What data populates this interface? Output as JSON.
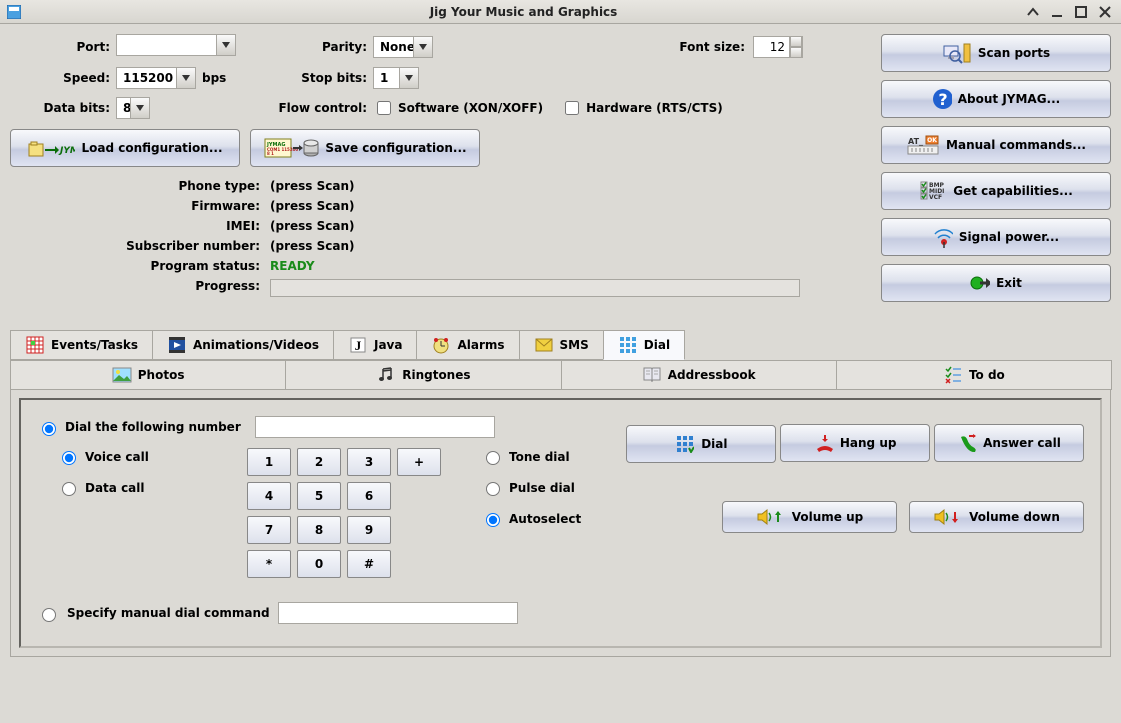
{
  "window": {
    "title": "Jig Your Music and Graphics"
  },
  "settings": {
    "port_label": "Port:",
    "port_value": "",
    "speed_label": "Speed:",
    "speed_value": "115200",
    "speed_unit": "bps",
    "databits_label": "Data bits:",
    "databits_value": "8",
    "parity_label": "Parity:",
    "parity_value": "None",
    "stopbits_label": "Stop bits:",
    "stopbits_value": "1",
    "flow_label": "Flow control:",
    "flow_software": "Software (XON/XOFF)",
    "flow_hardware": "Hardware (RTS/CTS)",
    "fontsize_label": "Font size:",
    "fontsize_value": "12"
  },
  "buttons": {
    "load_config": "Load configuration...",
    "save_config": "Save configuration...",
    "scan_ports": "Scan ports",
    "about": "About JYMAG...",
    "manual_cmds": "Manual commands...",
    "capabilities": "Get capabilities...",
    "signal": "Signal power...",
    "exit": "Exit"
  },
  "info": {
    "phone_type_label": "Phone type:",
    "phone_type_value": "(press Scan)",
    "firmware_label": "Firmware:",
    "firmware_value": "(press Scan)",
    "imei_label": "IMEI:",
    "imei_value": "(press Scan)",
    "subscriber_label": "Subscriber number:",
    "subscriber_value": "(press Scan)",
    "status_label": "Program status:",
    "status_value": "READY",
    "progress_label": "Progress:"
  },
  "tabs": {
    "events": "Events/Tasks",
    "animations": "Animations/Videos",
    "java": "Java",
    "alarms": "Alarms",
    "sms": "SMS",
    "dial": "Dial",
    "photos": "Photos",
    "ringtones": "Ringtones",
    "addressbook": "Addressbook",
    "todo": "To do"
  },
  "dial": {
    "dial_following": "Dial the following number",
    "voice_call": "Voice call",
    "data_call": "Data call",
    "tone_dial": "Tone dial",
    "pulse_dial": "Pulse dial",
    "autoselect": "Autoselect",
    "specify_manual": "Specify manual dial command",
    "keys": {
      "k1": "1",
      "k2": "2",
      "k3": "3",
      "kp": "+",
      "k4": "4",
      "k5": "5",
      "k6": "6",
      "k7": "7",
      "k8": "8",
      "k9": "9",
      "ks": "*",
      "k0": "0",
      "kh": "#"
    },
    "btn_dial": "Dial",
    "btn_hangup": "Hang up",
    "btn_answer": "Answer call",
    "btn_volup": "Volume up",
    "btn_voldown": "Volume down"
  }
}
